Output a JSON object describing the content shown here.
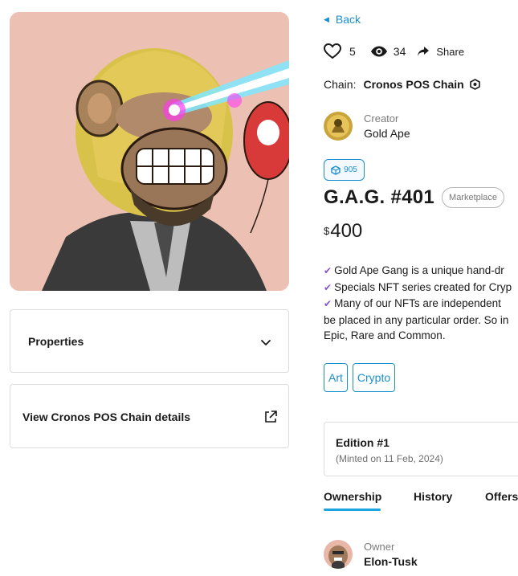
{
  "navigation": {
    "back_label": "Back"
  },
  "stats": {
    "likes": "5",
    "views": "34",
    "share_label": "Share"
  },
  "chain": {
    "label": "Chain:",
    "name": "Cronos POS Chain"
  },
  "creator": {
    "role": "Creator",
    "name": "Gold Ape"
  },
  "collection_badge": {
    "count": "905"
  },
  "nft": {
    "title": "G.A.G. #401",
    "marketplace_label": "Marketplace"
  },
  "price": {
    "currency": "$",
    "amount": "400"
  },
  "description": [
    "Gold Ape Gang is a unique hand-dr",
    "Specials NFT series created for Cryp",
    "Many of our NFTs are independent",
    "be placed in any particular order. So in",
    "Epic, Rare and Common."
  ],
  "tags": [
    "Art",
    "Crypto"
  ],
  "edition": {
    "title": "Edition #1",
    "minted": "(Minted on 11 Feb, 2024)"
  },
  "tabs": [
    "Ownership",
    "History",
    "Offers"
  ],
  "owner": {
    "role": "Owner",
    "name": "Elon-Tusk"
  },
  "left_panels": {
    "properties_label": "Properties",
    "chain_details_label": "View Cronos POS Chain details"
  },
  "colors": {
    "accent": "#1a8fd0",
    "tab_underline": "#1aa4e0",
    "check": "#8a55d0",
    "image_bg": "#ecc0b3"
  },
  "icons": {
    "like": "heart-icon",
    "views": "eye-icon",
    "share": "share-icon",
    "chain": "hexagon-icon",
    "properties": "chevron-down-icon",
    "chain_details": "external-link-icon",
    "check": "check-icon",
    "back": "caret-left-icon"
  }
}
